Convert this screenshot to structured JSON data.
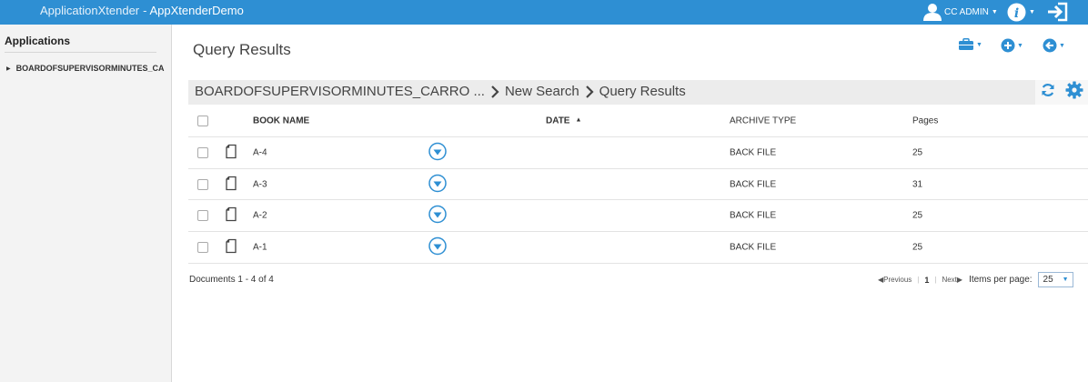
{
  "topbar": {
    "app_name": "ApplicationXtender",
    "separator": "-",
    "app_instance": "AppXtenderDemo",
    "user_name": "CC ADMIN",
    "user_icon": "user-icon",
    "info_icon": "info-icon",
    "logout_icon": "logout-icon"
  },
  "sidebar": {
    "title": "Applications",
    "items": [
      {
        "label": "BOARDOFSUPERVISORMINUTES_CA"
      }
    ]
  },
  "main": {
    "title": "Query Results",
    "toolbar": {
      "icons": [
        "briefcase-icon",
        "add-circle-icon",
        "back-circle-icon"
      ]
    },
    "breadcrumb": [
      "BOARDOFSUPERVISORMINUTES_CARRO ...",
      "New Search",
      "Query Results"
    ],
    "breadcrumb_icons": [
      "refresh-icon",
      "settings-gear-icon"
    ]
  },
  "table": {
    "columns": [
      "BOOK NAME",
      "DATE",
      "ARCHIVE TYPE",
      "Pages"
    ],
    "rows": [
      {
        "name": "A-4",
        "date": "",
        "archive_type": "BACK FILE",
        "pages": "25"
      },
      {
        "name": "A-3",
        "date": "",
        "archive_type": "BACK FILE",
        "pages": "31"
      },
      {
        "name": "A-2",
        "date": "",
        "archive_type": "BACK FILE",
        "pages": "25"
      },
      {
        "name": "A-1",
        "date": "",
        "archive_type": "BACK FILE",
        "pages": "25"
      }
    ]
  },
  "footer": {
    "count_text": "Documents 1 - 4 of 4",
    "previous": "Previous",
    "current_page": "1",
    "next": "Next",
    "items_per_page_label": "Items per page:",
    "items_per_page_value": "25"
  },
  "colors": {
    "accent": "#2e8fd3",
    "topbar": "#2e8fd3"
  }
}
